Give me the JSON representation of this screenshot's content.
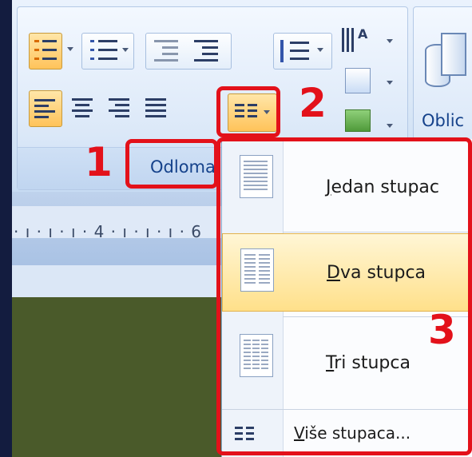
{
  "ribbon": {
    "paragraph_group_label": "Odloma",
    "shapes_button_label": "Oblic"
  },
  "callouts": {
    "one": "1",
    "two": "2",
    "three": "3"
  },
  "ruler": {
    "text": "· ı · ı · ı · 4 · ı · ı · ı · 6"
  },
  "columns_menu": {
    "items": [
      {
        "label": "Jedan stupac",
        "columns": 1
      },
      {
        "label": "Dva stupca",
        "columns": 2,
        "highlighted": true
      },
      {
        "label": "Tri stupca",
        "columns": 3
      }
    ],
    "more_label": "Više stupaca..."
  },
  "colors": {
    "callout_red": "#e3111a",
    "accent_orange": "#ffc35a",
    "ribbon_text": "#15428b"
  }
}
